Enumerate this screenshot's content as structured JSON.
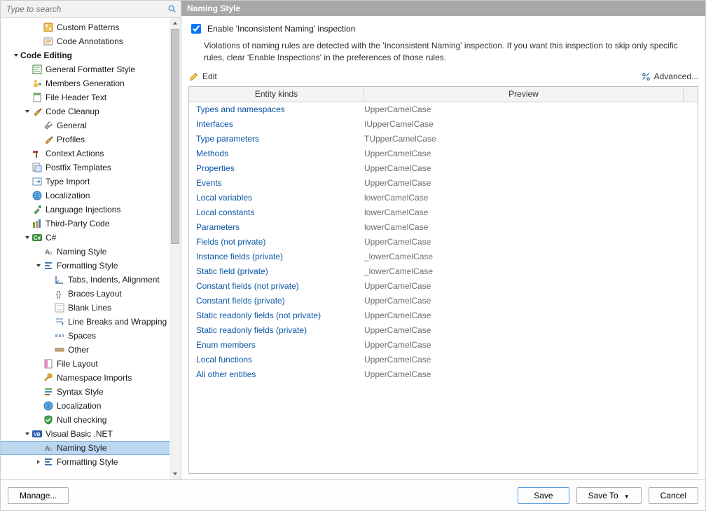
{
  "search": {
    "placeholder": "Type to search"
  },
  "tree": {
    "items": [
      {
        "depth": 2,
        "twist": "",
        "icon": "patterns",
        "label": "Custom Patterns"
      },
      {
        "depth": 2,
        "twist": "",
        "icon": "annotations",
        "label": "Code Annotations"
      },
      {
        "depth": 0,
        "twist": "down",
        "icon": "",
        "label": "Code Editing",
        "bold": true
      },
      {
        "depth": 1,
        "twist": "",
        "icon": "formatter",
        "label": "General Formatter Style"
      },
      {
        "depth": 1,
        "twist": "",
        "icon": "members",
        "label": "Members Generation"
      },
      {
        "depth": 1,
        "twist": "",
        "icon": "fileheader",
        "label": "File Header Text"
      },
      {
        "depth": 1,
        "twist": "down",
        "icon": "broom",
        "label": "Code Cleanup"
      },
      {
        "depth": 2,
        "twist": "",
        "icon": "wrench",
        "label": "General"
      },
      {
        "depth": 2,
        "twist": "",
        "icon": "broom",
        "label": "Profiles"
      },
      {
        "depth": 1,
        "twist": "",
        "icon": "hammer",
        "label": "Context Actions"
      },
      {
        "depth": 1,
        "twist": "",
        "icon": "templates",
        "label": "Postfix Templates"
      },
      {
        "depth": 1,
        "twist": "",
        "icon": "typeimport",
        "label": "Type Import"
      },
      {
        "depth": 1,
        "twist": "",
        "icon": "globe",
        "label": "Localization"
      },
      {
        "depth": 1,
        "twist": "",
        "icon": "inject",
        "label": "Language Injections"
      },
      {
        "depth": 1,
        "twist": "",
        "icon": "thirdparty",
        "label": "Third-Party Code"
      },
      {
        "depth": 1,
        "twist": "down",
        "icon": "csharp",
        "label": "C#"
      },
      {
        "depth": 2,
        "twist": "",
        "icon": "naming",
        "label": "Naming Style"
      },
      {
        "depth": 2,
        "twist": "down",
        "icon": "formatting",
        "label": "Formatting Style"
      },
      {
        "depth": 3,
        "twist": "",
        "icon": "tabs",
        "label": "Tabs, Indents, Alignment"
      },
      {
        "depth": 3,
        "twist": "",
        "icon": "braces",
        "label": "Braces Layout"
      },
      {
        "depth": 3,
        "twist": "",
        "icon": "blank",
        "label": "Blank Lines"
      },
      {
        "depth": 3,
        "twist": "",
        "icon": "wrap",
        "label": "Line Breaks and Wrapping"
      },
      {
        "depth": 3,
        "twist": "",
        "icon": "spaces",
        "label": "Spaces"
      },
      {
        "depth": 3,
        "twist": "",
        "icon": "other",
        "label": "Other"
      },
      {
        "depth": 2,
        "twist": "",
        "icon": "filelayout",
        "label": "File Layout"
      },
      {
        "depth": 2,
        "twist": "",
        "icon": "pin",
        "label": "Namespace Imports"
      },
      {
        "depth": 2,
        "twist": "",
        "icon": "syntax",
        "label": "Syntax Style"
      },
      {
        "depth": 2,
        "twist": "",
        "icon": "globe",
        "label": "Localization"
      },
      {
        "depth": 2,
        "twist": "",
        "icon": "shield",
        "label": "Null checking"
      },
      {
        "depth": 1,
        "twist": "down",
        "icon": "vb",
        "label": "Visual Basic .NET"
      },
      {
        "depth": 2,
        "twist": "",
        "icon": "naming",
        "label": "Naming Style",
        "selected": true
      },
      {
        "depth": 2,
        "twist": "right",
        "icon": "formatting",
        "label": "Formatting Style"
      }
    ]
  },
  "panel": {
    "title": "Naming Style",
    "checkbox_label": "Enable 'Inconsistent Naming' inspection",
    "description": "Violations of naming rules are detected with the 'Inconsistent Naming' inspection. If you want this inspection to skip only specific rules, clear 'Enable Inspections' in the preferences of those rules.",
    "edit_label": "Edit",
    "advanced_label": "Advanced...",
    "columns": {
      "c1": "Entity kinds",
      "c2": "Preview"
    },
    "rows": [
      {
        "k": "Types and namespaces",
        "p": "UpperCamelCase"
      },
      {
        "k": "Interfaces",
        "p": "IUpperCamelCase"
      },
      {
        "k": "Type parameters",
        "p": "TUpperCamelCase"
      },
      {
        "k": "Methods",
        "p": "UpperCamelCase"
      },
      {
        "k": "Properties",
        "p": "UpperCamelCase"
      },
      {
        "k": "Events",
        "p": "UpperCamelCase"
      },
      {
        "k": "Local variables",
        "p": "lowerCamelCase"
      },
      {
        "k": "Local constants",
        "p": "lowerCamelCase"
      },
      {
        "k": "Parameters",
        "p": "lowerCamelCase"
      },
      {
        "k": "Fields (not private)",
        "p": "UpperCamelCase"
      },
      {
        "k": "Instance fields (private)",
        "p": "_lowerCamelCase"
      },
      {
        "k": "Static field (private)",
        "p": "_lowerCamelCase"
      },
      {
        "k": "Constant fields (not private)",
        "p": "UpperCamelCase"
      },
      {
        "k": "Constant fields (private)",
        "p": "UpperCamelCase"
      },
      {
        "k": "Static readonly fields (not private)",
        "p": "UpperCamelCase"
      },
      {
        "k": "Static readonly fields (private)",
        "p": "UpperCamelCase"
      },
      {
        "k": "Enum members",
        "p": "UpperCamelCase"
      },
      {
        "k": "Local functions",
        "p": "UpperCamelCase"
      },
      {
        "k": "All other entities",
        "p": "UpperCamelCase"
      }
    ]
  },
  "footer": {
    "manage": "Manage...",
    "save": "Save",
    "save_to": "Save To",
    "cancel": "Cancel"
  }
}
